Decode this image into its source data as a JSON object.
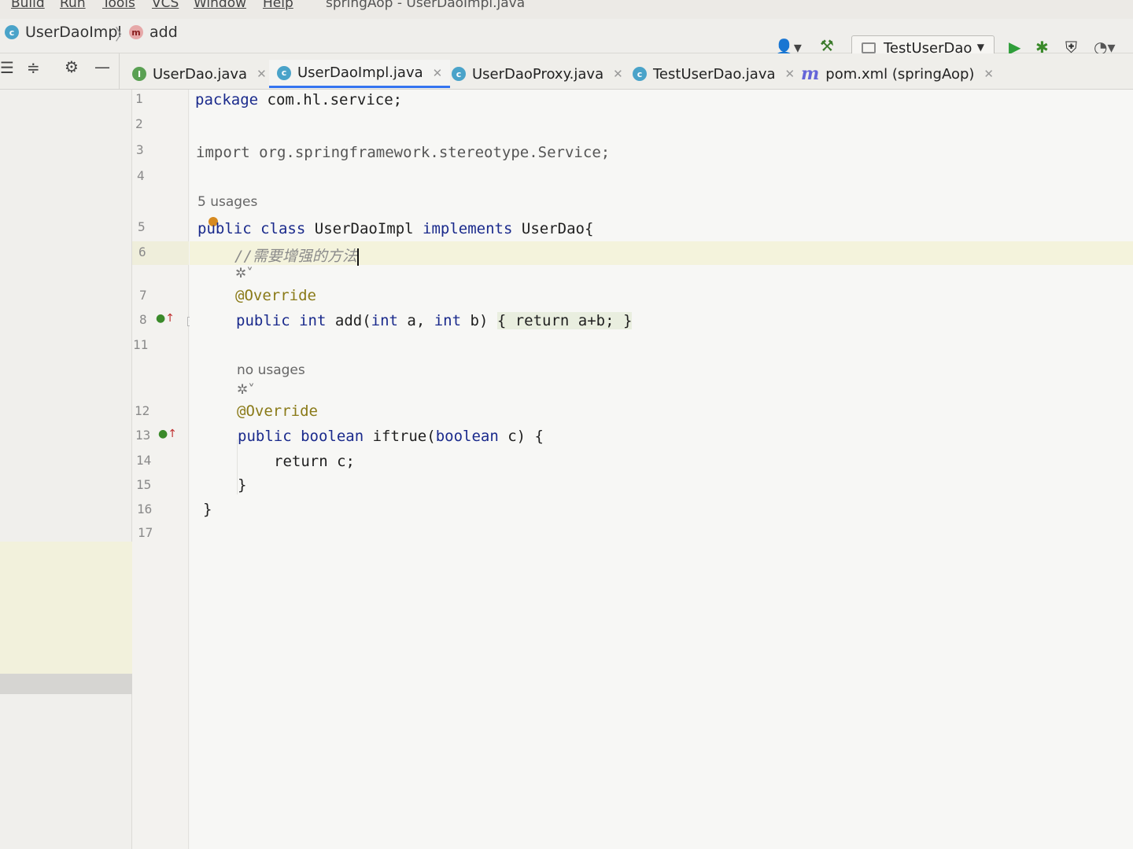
{
  "menubar": {
    "items": [
      "Build",
      "Run",
      "Tools",
      "VCS",
      "Window",
      "Help"
    ],
    "title": "springAop - UserDaoImpl.java"
  },
  "breadcrumb": {
    "class_name": "UserDaoImpl",
    "method_name": "add"
  },
  "toolbar": {
    "run_config": "TestUserDao"
  },
  "tabs": [
    {
      "label": "UserDao.java",
      "icon": "interface-icon",
      "active": false
    },
    {
      "label": "UserDaoImpl.java",
      "icon": "class-icon",
      "active": true
    },
    {
      "label": "UserDaoProxy.java",
      "icon": "class-icon",
      "active": false
    },
    {
      "label": "TestUserDao.java",
      "icon": "test-class-icon",
      "active": false
    },
    {
      "label": "pom.xml (springAop)",
      "icon": "maven-icon",
      "active": false
    }
  ],
  "editor": {
    "line_numbers": [
      "1",
      "2",
      "3",
      "4",
      "5",
      "6",
      "7",
      "8",
      "11",
      "12",
      "13",
      "14",
      "15",
      "16",
      "17"
    ],
    "hints": {
      "usages_5": "5 usages",
      "no_usages": "no usages"
    },
    "code": {
      "l1_kw": "package",
      "l1_rest": " com.hl.service;",
      "l3": "import org.springframework.stereotype.Service;",
      "l5_kw1": "public",
      "l5_kw2": "class",
      "l5_name": "UserDaoImpl",
      "l5_kw3": "implements",
      "l5_rest": "UserDao{",
      "l6_comment": "//需要增强的方法",
      "l7_ann": "@Override",
      "l8_kw1": "public",
      "l8_kw2": "int",
      "l8_sig1": "add(",
      "l8_kw3": "int",
      "l8_sig2": " a, ",
      "l8_kw4": "int",
      "l8_sig3": " b) ",
      "l8_body": "{ return a+b; }",
      "l12_ann": "@Override",
      "l13_kw1": "public",
      "l13_kw2": "boolean",
      "l13_sig1": " iftrue(",
      "l13_kw3": "boolean",
      "l13_sig2": " c) {",
      "l14": "return c;",
      "l15": "}",
      "l16": "}"
    }
  }
}
